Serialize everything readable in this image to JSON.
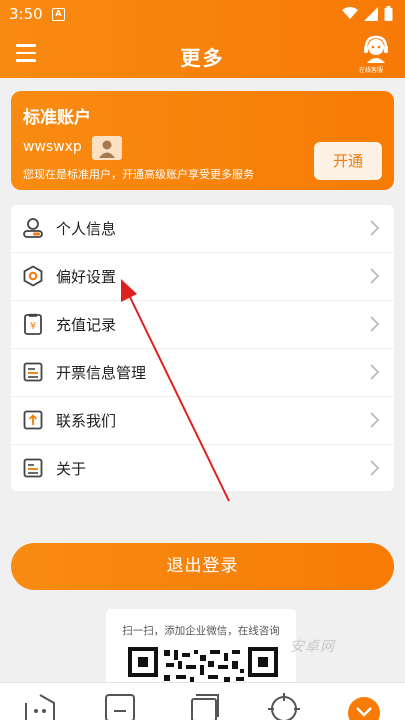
{
  "status": {
    "time": "3:50",
    "a_badge": "A"
  },
  "header": {
    "title": "更多",
    "service_label": "在线客服"
  },
  "account": {
    "title": "标准账户",
    "username": "wwswxp",
    "description": "您现在是标准用户，开通高级账户享受更多服务",
    "open_button": "开通"
  },
  "menu": [
    {
      "label": "个人信息",
      "icon": "person-icon"
    },
    {
      "label": "偏好设置",
      "icon": "hexagon-settings-icon"
    },
    {
      "label": "充值记录",
      "icon": "recharge-record-icon"
    },
    {
      "label": "开票信息管理",
      "icon": "invoice-icon"
    },
    {
      "label": "联系我们",
      "icon": "contact-icon"
    },
    {
      "label": "关于",
      "icon": "about-icon"
    }
  ],
  "logout_label": "退出登录",
  "qr": {
    "text": "扫一扫，添加企业微信，在线咨询"
  },
  "watermark": "安卓网",
  "colors": {
    "accent": "#f77b05",
    "accent_light": "#fdf2e3",
    "background": "#f0f0f0",
    "arrow": "#e02020"
  }
}
